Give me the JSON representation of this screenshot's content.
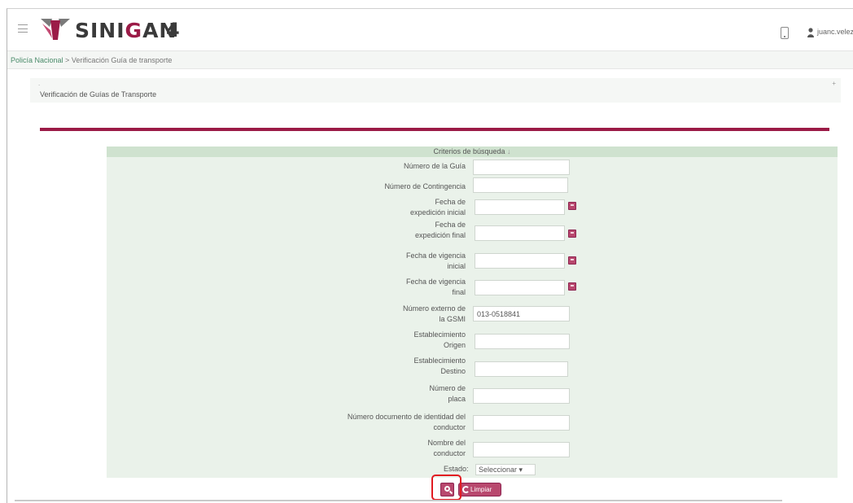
{
  "header": {
    "logo_text_pre": "SINI",
    "logo_text_accent": "G",
    "logo_text_post": "AN",
    "logo_version": "4",
    "user_name": "juanc.velez",
    "brand_color": "#9b1b47"
  },
  "breadcrumb": {
    "parent": "Policía Nacional",
    "separator": " > ",
    "current": "Verificación Guía de transporte"
  },
  "panel": {
    "dot": ".",
    "toggle": "+",
    "title": "Verificación de Guías de Transporte"
  },
  "criteria": {
    "header": "Criterios de búsqueda",
    "fields": [
      {
        "label_lines": [
          "Número de la Guía"
        ],
        "value": ""
      },
      {
        "label_lines": [
          "Número de Contingencia"
        ],
        "value": ""
      },
      {
        "label_lines": [
          "Fecha de",
          "expedición inicial"
        ],
        "value": "",
        "calendar": true
      },
      {
        "label_lines": [
          "Fecha de",
          "expedición final"
        ],
        "value": "",
        "calendar": true
      },
      {
        "label_lines": [
          "Fecha de vigencia",
          "inicial"
        ],
        "value": "",
        "calendar": true
      },
      {
        "label_lines": [
          "Fecha de vigencia",
          "final"
        ],
        "value": "",
        "calendar": true
      },
      {
        "label_lines": [
          "Número externo de",
          "la GSMI"
        ],
        "value": "013-0518841"
      },
      {
        "label_lines": [
          "Establecimiento",
          "Origen"
        ],
        "value": ""
      },
      {
        "label_lines": [
          "Establecimiento",
          "Destino"
        ],
        "value": ""
      },
      {
        "label_lines": [
          "Número de",
          "placa"
        ],
        "value": ""
      },
      {
        "label_lines": [
          "Número documento de identidad del",
          "conductor"
        ],
        "value": ""
      },
      {
        "label_lines": [
          "Nombre del",
          "conductor"
        ],
        "value": ""
      }
    ],
    "estado_label": "Estado:",
    "estado_value": "Seleccionar"
  },
  "actions": {
    "clear_label": "Limpiar"
  }
}
